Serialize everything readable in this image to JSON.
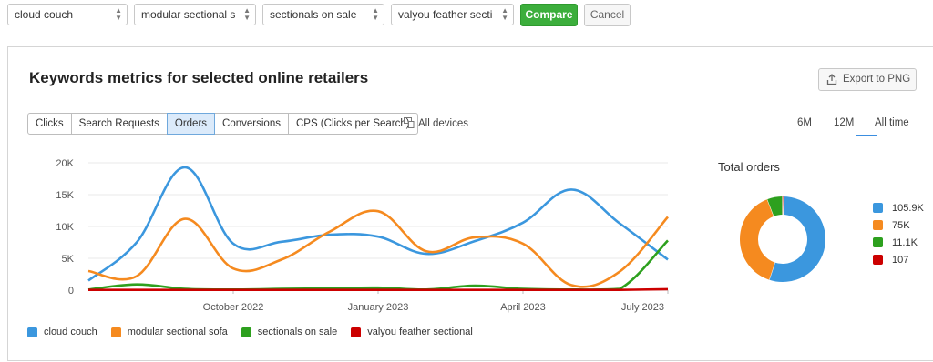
{
  "filters": {
    "selects": [
      "cloud couch",
      "modular sectional s",
      "sectionals on sale",
      "valyou feather secti"
    ],
    "compare_label": "Compare",
    "cancel_label": "Cancel"
  },
  "panel": {
    "title": "Keywords metrics for selected online retailers",
    "export_label": "Export to PNG",
    "tabs": [
      "Clicks",
      "Search Requests",
      "Orders",
      "Conversions",
      "CPS (Clicks per Search)"
    ],
    "active_tab": "Orders",
    "devices_label": "All devices",
    "periods": [
      "6M",
      "12M",
      "All time"
    ],
    "active_period": "All time"
  },
  "colors": {
    "cloud_couch": "#3b97de",
    "modular_sectional_sofa": "#f58a1f",
    "sectionals_on_sale": "#2da01e",
    "valyou_feather_sectional": "#cc0000",
    "compare_button": "#3cae3c",
    "active_tab": "#dbeafa"
  },
  "chart_data": [
    {
      "type": "line",
      "x_tick_labels": [
        "October 2022",
        "January 2023",
        "April 2023",
        "July 2023"
      ],
      "y_tick_labels": [
        "0",
        "5K",
        "10K",
        "15K",
        "20K"
      ],
      "ylim": [
        0,
        20000
      ],
      "grid": true,
      "legend_position": "bottom-left",
      "x": [
        "2022-07",
        "2022-08",
        "2022-09",
        "2022-10",
        "2022-11",
        "2022-12",
        "2023-01",
        "2023-02",
        "2023-03",
        "2023-04",
        "2023-05",
        "2023-06",
        "2023-07"
      ],
      "series": [
        {
          "name": "cloud couch",
          "color": "#3b97de",
          "values": [
            1500,
            7500,
            19300,
            7300,
            7600,
            8700,
            8400,
            5700,
            7700,
            10600,
            15800,
            10500,
            4800
          ]
        },
        {
          "name": "modular sectional sofa",
          "color": "#f58a1f",
          "values": [
            3000,
            2200,
            11200,
            3400,
            4800,
            9200,
            12400,
            6100,
            8300,
            7300,
            800,
            2900,
            11500
          ]
        },
        {
          "name": "sectionals on sale",
          "color": "#2da01e",
          "values": [
            100,
            900,
            200,
            100,
            200,
            300,
            400,
            100,
            700,
            200,
            100,
            200,
            7800
          ]
        },
        {
          "name": "valyou feather sectional",
          "color": "#cc0000",
          "values": [
            50,
            50,
            50,
            50,
            50,
            50,
            50,
            50,
            50,
            50,
            50,
            50,
            150
          ]
        }
      ]
    },
    {
      "type": "pie",
      "title": "Total orders",
      "slices": [
        {
          "label": "105.9K",
          "value": 105900,
          "color": "#3b97de"
        },
        {
          "label": "75K",
          "value": 75000,
          "color": "#f58a1f"
        },
        {
          "label": "11.1K",
          "value": 11100,
          "color": "#2da01e"
        },
        {
          "label": "107",
          "value": 107,
          "color": "#cc0000"
        }
      ]
    }
  ]
}
